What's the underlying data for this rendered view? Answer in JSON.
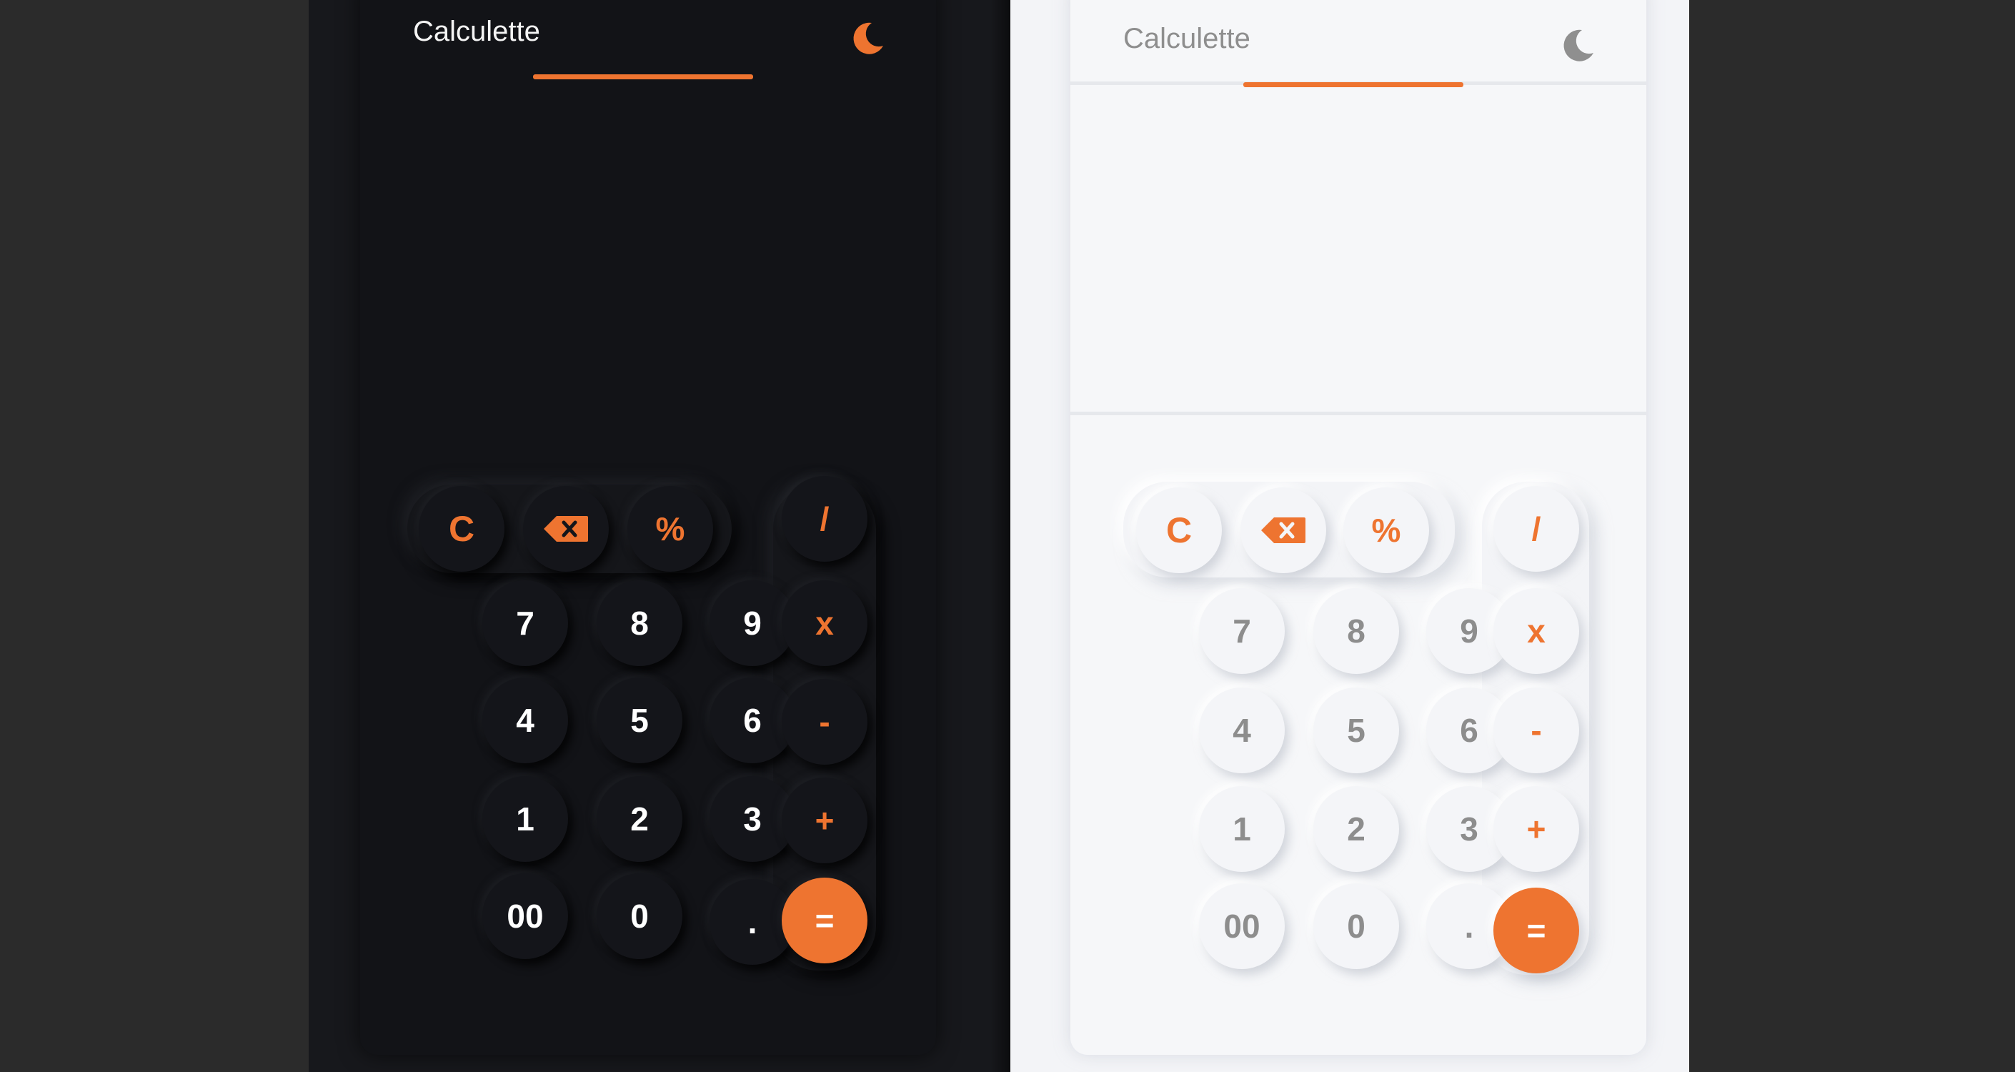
{
  "dark": {
    "title": "Calculette",
    "display_value": "",
    "keys": {
      "clear": "C",
      "percent": "%",
      "divide": "/",
      "seven": "7",
      "eight": "8",
      "nine": "9",
      "multiply": "x",
      "four": "4",
      "five": "5",
      "six": "6",
      "minus": "-",
      "one": "1",
      "two": "2",
      "three": "3",
      "plus": "+",
      "double_zero": "00",
      "zero": "0",
      "decimal": ".",
      "equals": "="
    },
    "icons": {
      "backspace": "backspace-icon",
      "theme_toggle": "moon-icon"
    },
    "colors": {
      "accent": "#ee7430",
      "background": "#121317",
      "digit_text": "#ffffff"
    }
  },
  "light": {
    "title": "Calculette",
    "display_value": "",
    "keys": {
      "clear": "C",
      "percent": "%",
      "divide": "/",
      "seven": "7",
      "eight": "8",
      "nine": "9",
      "multiply": "x",
      "four": "4",
      "five": "5",
      "six": "6",
      "minus": "-",
      "one": "1",
      "two": "2",
      "three": "3",
      "plus": "+",
      "double_zero": "00",
      "zero": "0",
      "decimal": ".",
      "equals": "="
    },
    "icons": {
      "backspace": "backspace-icon",
      "theme_toggle": "moon-icon"
    },
    "colors": {
      "accent": "#ee7430",
      "background": "#f6f7f9",
      "digit_text": "#8d8d8d"
    }
  }
}
